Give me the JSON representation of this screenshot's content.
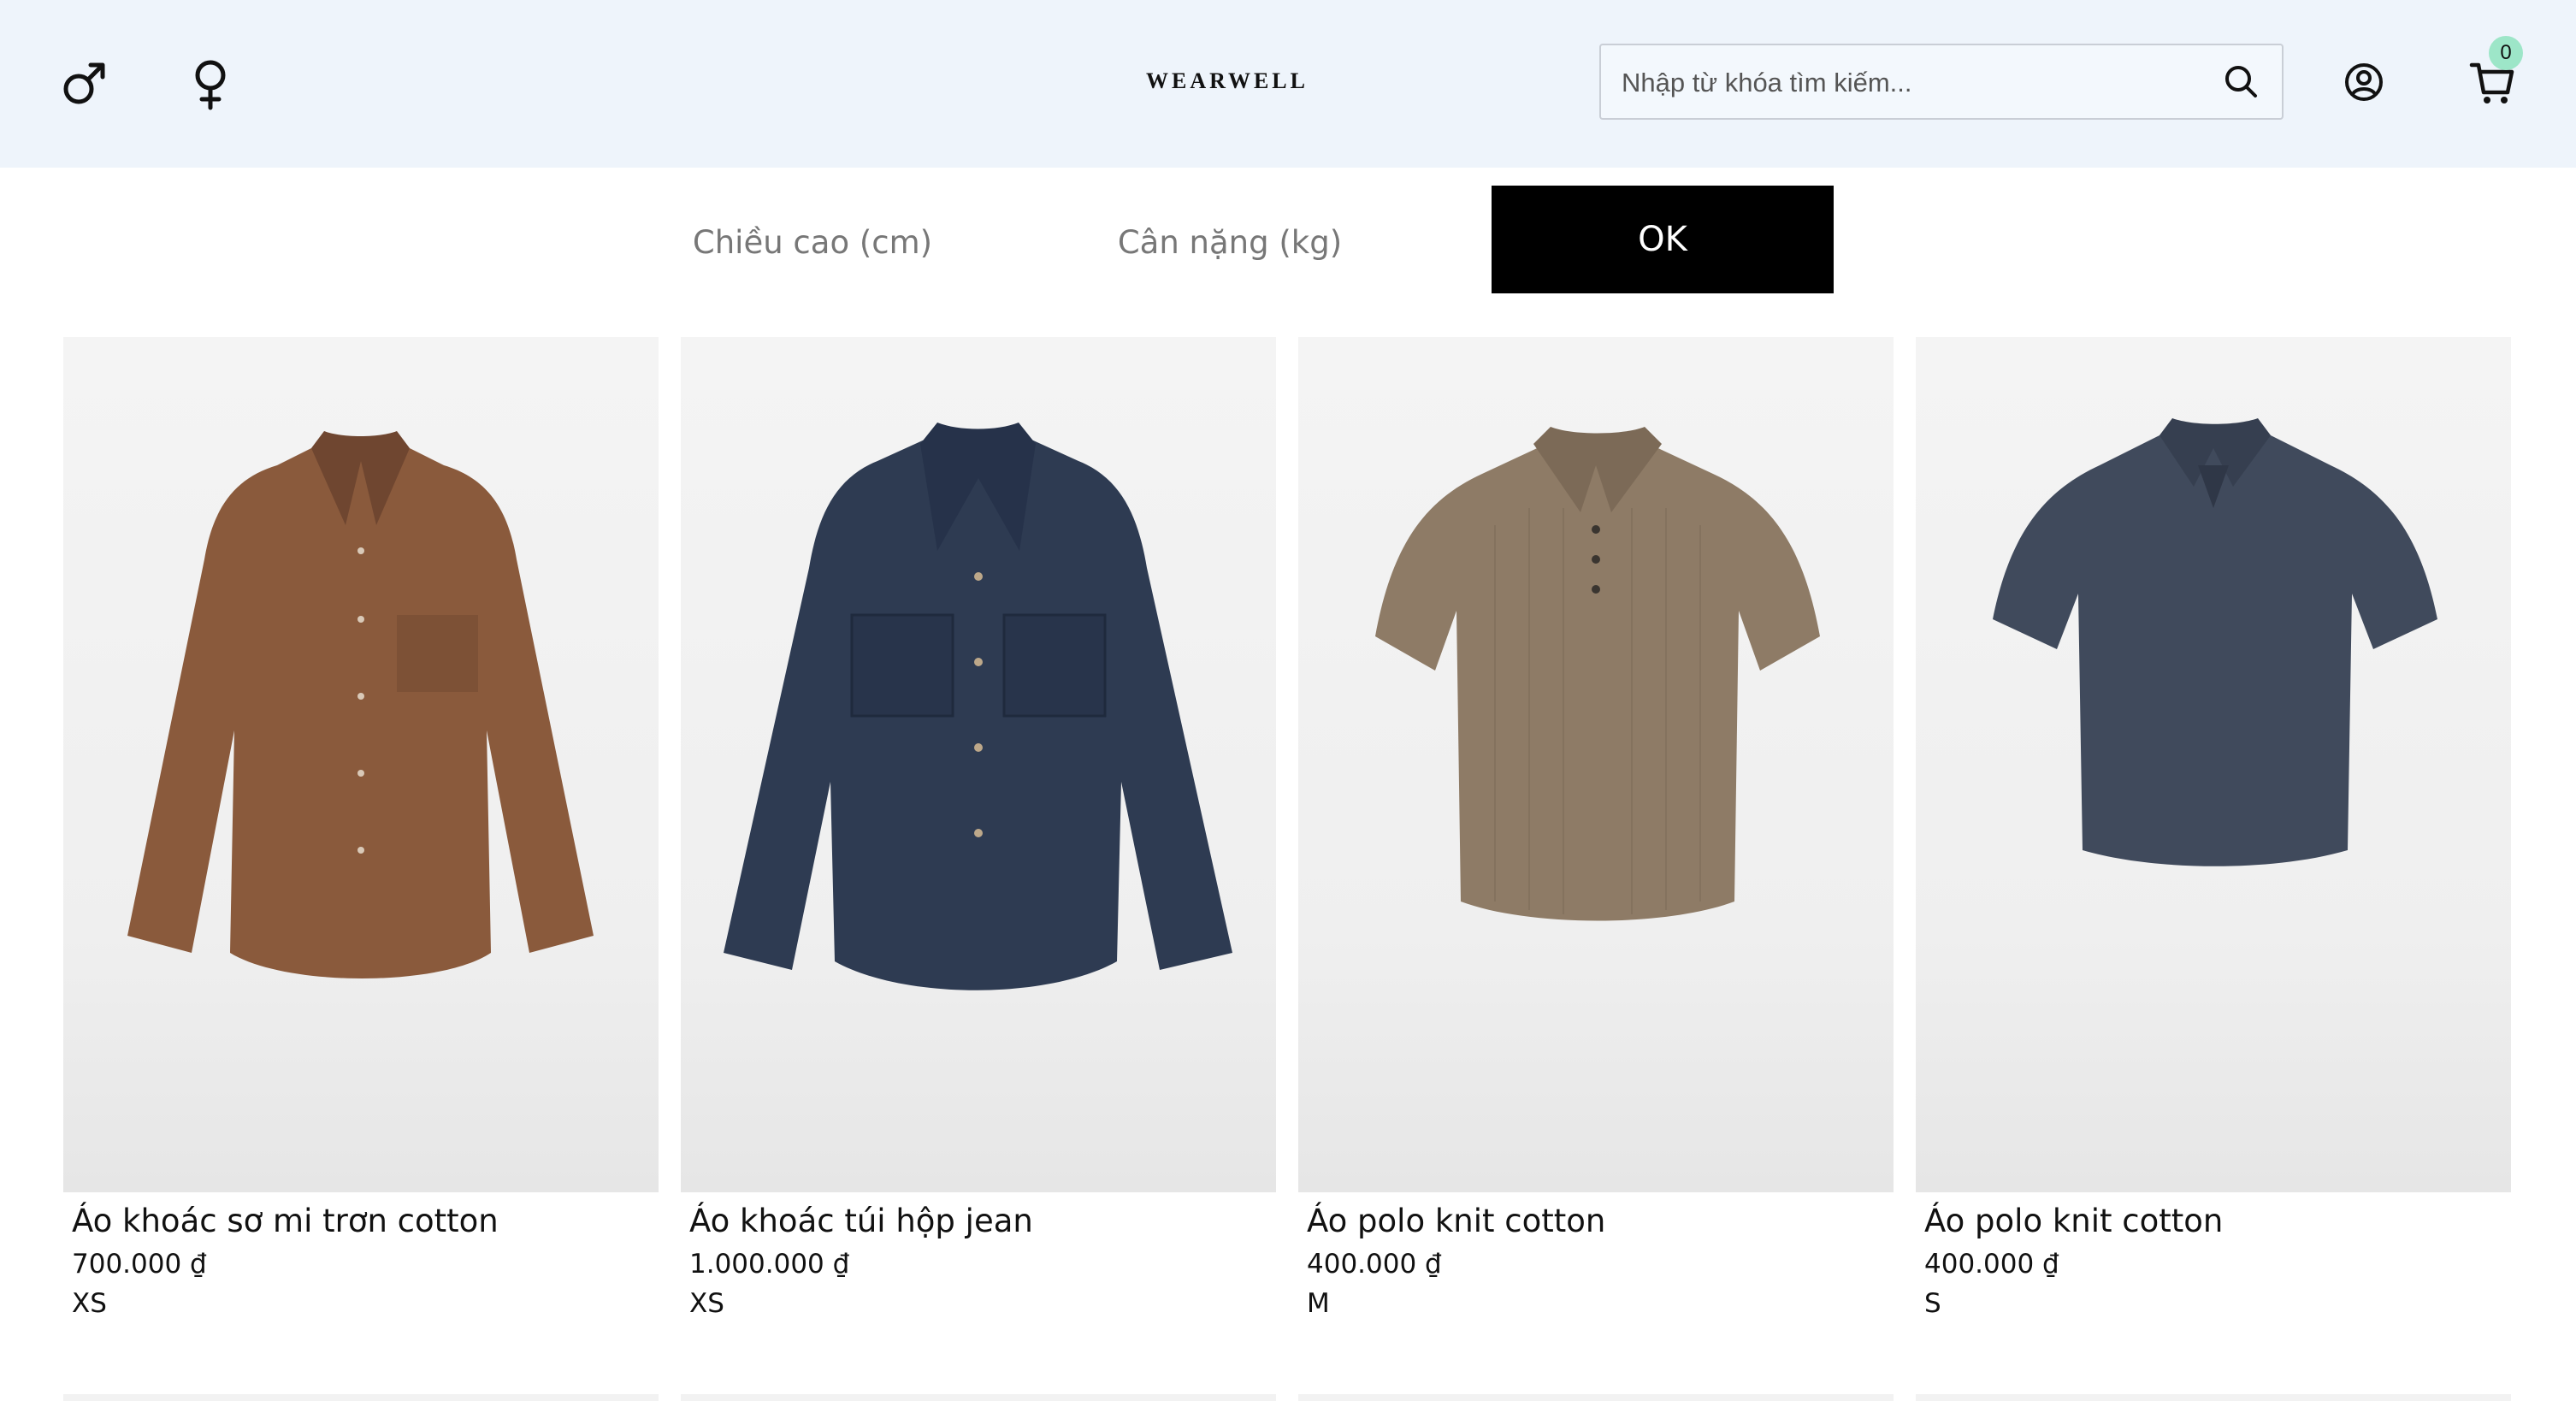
{
  "header": {
    "logo": "WEARWELL",
    "search": {
      "placeholder": "Nhập từ khóa tìm kiếm..."
    },
    "cart_count": "0",
    "icons": [
      "male-icon",
      "female-icon",
      "search-icon",
      "user-icon",
      "cart-icon"
    ]
  },
  "measure": {
    "height_placeholder": "Chiều cao (cm)",
    "weight_placeholder": "Cân nặng (kg)",
    "ok_label": "OK"
  },
  "products": [
    {
      "name": "Áo khoác sơ mi trơn cotton",
      "price": "700.000 ₫",
      "size": "XS",
      "color": "#8a5a3c"
    },
    {
      "name": "Áo khoác túi hộp jean",
      "price": "1.000.000 ₫",
      "size": "XS",
      "color": "#2e3b52"
    },
    {
      "name": "Áo polo knit cotton",
      "price": "400.000 ₫",
      "size": "M",
      "color": "#8e7b66"
    },
    {
      "name": "Áo polo knit cotton",
      "price": "400.000 ₫",
      "size": "S",
      "color": "#404a5c"
    }
  ],
  "colors": {
    "header_bg": "#eef4fb",
    "button_bg": "#000000",
    "badge_bg": "#9de6c8"
  }
}
